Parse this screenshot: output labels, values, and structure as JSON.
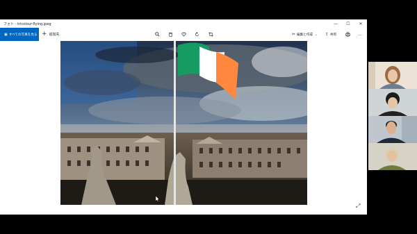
{
  "window": {
    "title": "フォト - tricolour-flying.jpeg",
    "controls": {
      "minimize": "—",
      "maximize": "☐",
      "close": "✕"
    }
  },
  "toolbar": {
    "all_photos_label": "すべての写真を見る",
    "add_label": "追加先",
    "edit_label": "編集と作成",
    "share_label": "共有",
    "more_label": "..."
  },
  "icons": {
    "photos": "photos-icon",
    "add": "plus-icon",
    "zoom": "zoom-icon",
    "delete": "trash-icon",
    "favorite": "heart-icon",
    "rotate": "rotate-icon",
    "crop": "crop-icon",
    "edit": "edit-icon",
    "share": "share-icon",
    "print": "print-icon",
    "expand": "expand-icon"
  },
  "colors": {
    "accent": "#0067c0",
    "flag_green": "#169b62",
    "flag_white": "#ffffff",
    "flag_orange": "#ff883e"
  }
}
